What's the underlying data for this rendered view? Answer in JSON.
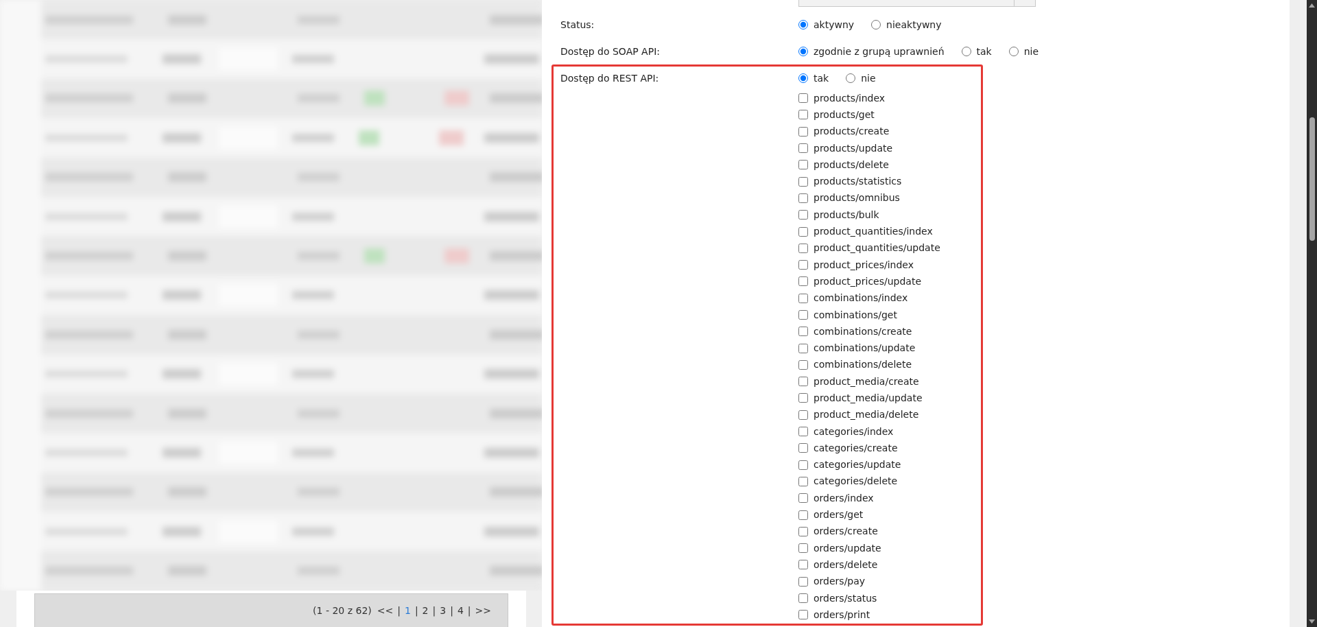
{
  "background_table": {
    "pagination": {
      "summary": "(1 - 20 z 62)",
      "first": "<<",
      "last": ">>",
      "separators": [
        "|",
        "|",
        "|",
        "|",
        "|"
      ],
      "pages": [
        {
          "label": "1",
          "selected": true
        },
        {
          "label": "2",
          "selected": false
        },
        {
          "label": "3",
          "selected": false
        },
        {
          "label": "4",
          "selected": false
        }
      ]
    }
  },
  "form": {
    "fields": [
      {
        "label": "Status:",
        "highlighted": false,
        "options": [
          {
            "label": "aktywny",
            "selected": true
          },
          {
            "label": "nieaktywny",
            "selected": false
          }
        ]
      },
      {
        "label": "Dostęp do SOAP API:",
        "highlighted": false,
        "options": [
          {
            "label": "zgodnie z grupą uprawnień",
            "selected": true
          },
          {
            "label": "tak",
            "selected": false
          },
          {
            "label": "nie",
            "selected": false
          }
        ]
      },
      {
        "label": "Dostęp do REST API:",
        "highlighted": true,
        "options": [
          {
            "label": "tak",
            "selected": true
          },
          {
            "label": "nie",
            "selected": false
          }
        ],
        "permissions": [
          {
            "label": "products/index",
            "checked": false
          },
          {
            "label": "products/get",
            "checked": false
          },
          {
            "label": "products/create",
            "checked": false
          },
          {
            "label": "products/update",
            "checked": false
          },
          {
            "label": "products/delete",
            "checked": false
          },
          {
            "label": "products/statistics",
            "checked": false
          },
          {
            "label": "products/omnibus",
            "checked": false
          },
          {
            "label": "products/bulk",
            "checked": false
          },
          {
            "label": "product_quantities/index",
            "checked": false
          },
          {
            "label": "product_quantities/update",
            "checked": false
          },
          {
            "label": "product_prices/index",
            "checked": false
          },
          {
            "label": "product_prices/update",
            "checked": false
          },
          {
            "label": "combinations/index",
            "checked": false
          },
          {
            "label": "combinations/get",
            "checked": false
          },
          {
            "label": "combinations/create",
            "checked": false
          },
          {
            "label": "combinations/update",
            "checked": false
          },
          {
            "label": "combinations/delete",
            "checked": false
          },
          {
            "label": "product_media/create",
            "checked": false
          },
          {
            "label": "product_media/update",
            "checked": false
          },
          {
            "label": "product_media/delete",
            "checked": false
          },
          {
            "label": "categories/index",
            "checked": false
          },
          {
            "label": "categories/create",
            "checked": false
          },
          {
            "label": "categories/update",
            "checked": false
          },
          {
            "label": "categories/delete",
            "checked": false
          },
          {
            "label": "orders/index",
            "checked": false
          },
          {
            "label": "orders/get",
            "checked": false
          },
          {
            "label": "orders/create",
            "checked": false
          },
          {
            "label": "orders/update",
            "checked": false
          },
          {
            "label": "orders/delete",
            "checked": false
          },
          {
            "label": "orders/pay",
            "checked": false
          },
          {
            "label": "orders/status",
            "checked": false
          },
          {
            "label": "orders/print",
            "checked": false
          }
        ]
      }
    ]
  }
}
